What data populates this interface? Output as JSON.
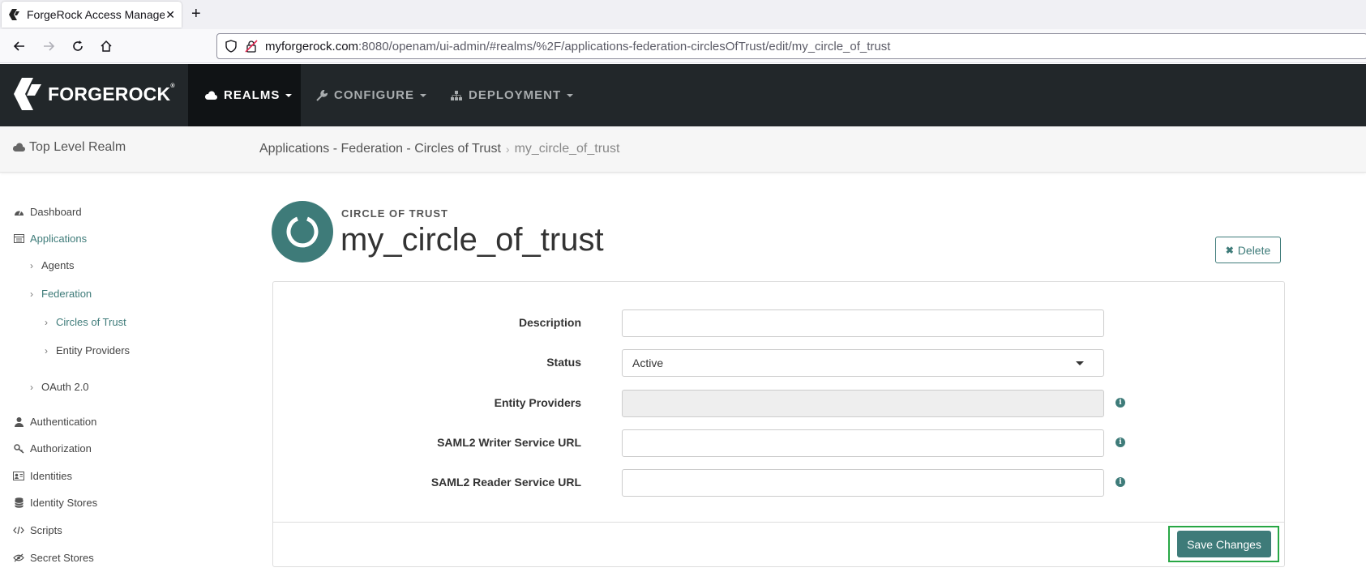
{
  "browser": {
    "tab_title": "ForgeRock Access Management",
    "url_host": "myforgerock.com",
    "url_path": ":8080/openam/ui-admin/#realms/%2F/applications-federation-circlesOfTrust/edit/my_circle_of_trust"
  },
  "header": {
    "brand": "FORGEROCK",
    "nav": [
      {
        "label": "REALMS",
        "icon": "cloud-icon",
        "active": true
      },
      {
        "label": "CONFIGURE",
        "icon": "wrench-icon",
        "active": false
      },
      {
        "label": "DEPLOYMENT",
        "icon": "sitemap-icon",
        "active": false
      }
    ]
  },
  "breadcrumb": {
    "realm": "Top Level Realm",
    "path": "Applications - Federation - Circles of Trust",
    "current": "my_circle_of_trust"
  },
  "sidebar": {
    "items": [
      {
        "label": "Dashboard",
        "icon": "dashboard-icon"
      },
      {
        "label": "Applications",
        "icon": "applications-icon",
        "active": true
      },
      {
        "label": "Agents"
      },
      {
        "label": "Federation",
        "active": true
      },
      {
        "label": "Circles of Trust",
        "active": true
      },
      {
        "label": "Entity Providers"
      },
      {
        "label": "OAuth 2.0"
      },
      {
        "label": "Authentication",
        "icon": "user-icon"
      },
      {
        "label": "Authorization",
        "icon": "key-icon"
      },
      {
        "label": "Identities",
        "icon": "id-card-icon"
      },
      {
        "label": "Identity Stores",
        "icon": "database-icon"
      },
      {
        "label": "Scripts",
        "icon": "code-icon"
      },
      {
        "label": "Secret Stores",
        "icon": "eye-slash-icon"
      }
    ]
  },
  "main": {
    "kicker": "CIRCLE OF TRUST",
    "title": "my_circle_of_trust",
    "delete_label": "Delete",
    "save_label": "Save Changes",
    "accent_color": "#3e7b79",
    "form": {
      "description_label": "Description",
      "description_value": "",
      "status_label": "Status",
      "status_value": "Active",
      "entity_providers_label": "Entity Providers",
      "writer_url_label": "SAML2 Writer Service URL",
      "reader_url_label": "SAML2 Reader Service URL"
    }
  }
}
